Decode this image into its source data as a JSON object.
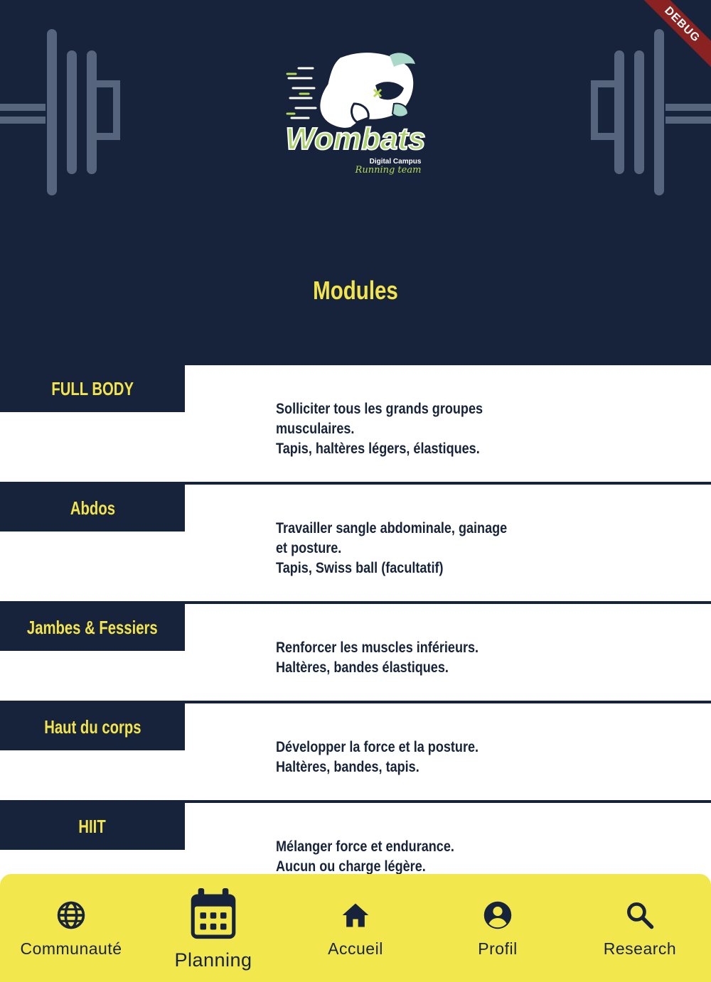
{
  "debug_banner": "DEBUG",
  "header": {
    "logo_brand": "Wombats",
    "logo_sub1": "Digital Campus",
    "logo_sub2": "Running team",
    "title": "Modules"
  },
  "modules": [
    {
      "name": "FULL BODY",
      "lines": [
        "Solliciter tous les grands groupes",
        "musculaires.",
        "Tapis, haltères légers, élastiques."
      ]
    },
    {
      "name": "Abdos",
      "lines": [
        "Travailler sangle abdominale, gainage",
        "et posture.",
        "Tapis, Swiss ball (facultatif)"
      ]
    },
    {
      "name": "Jambes & Fessiers",
      "lines": [
        "Renforcer les muscles inférieurs.",
        "Haltères, bandes élastiques."
      ]
    },
    {
      "name": "Haut du corps",
      "lines": [
        "Développer la force et la posture.",
        "Haltères, bandes, tapis."
      ]
    },
    {
      "name": "HIIT",
      "lines": [
        "Mélanger force et endurance.",
        "Aucun ou charge légère."
      ]
    }
  ],
  "navbar": {
    "items": [
      {
        "label": "Communauté",
        "icon": "globe-icon"
      },
      {
        "label": "Planning",
        "icon": "calendar-icon",
        "active": true
      },
      {
        "label": "Accueil",
        "icon": "home-icon"
      },
      {
        "label": "Profil",
        "icon": "account-circle-icon"
      },
      {
        "label": "Research",
        "icon": "search-icon"
      }
    ]
  },
  "colors": {
    "navy": "#17233a",
    "yellow": "#f2e44a",
    "white": "#ffffff"
  }
}
